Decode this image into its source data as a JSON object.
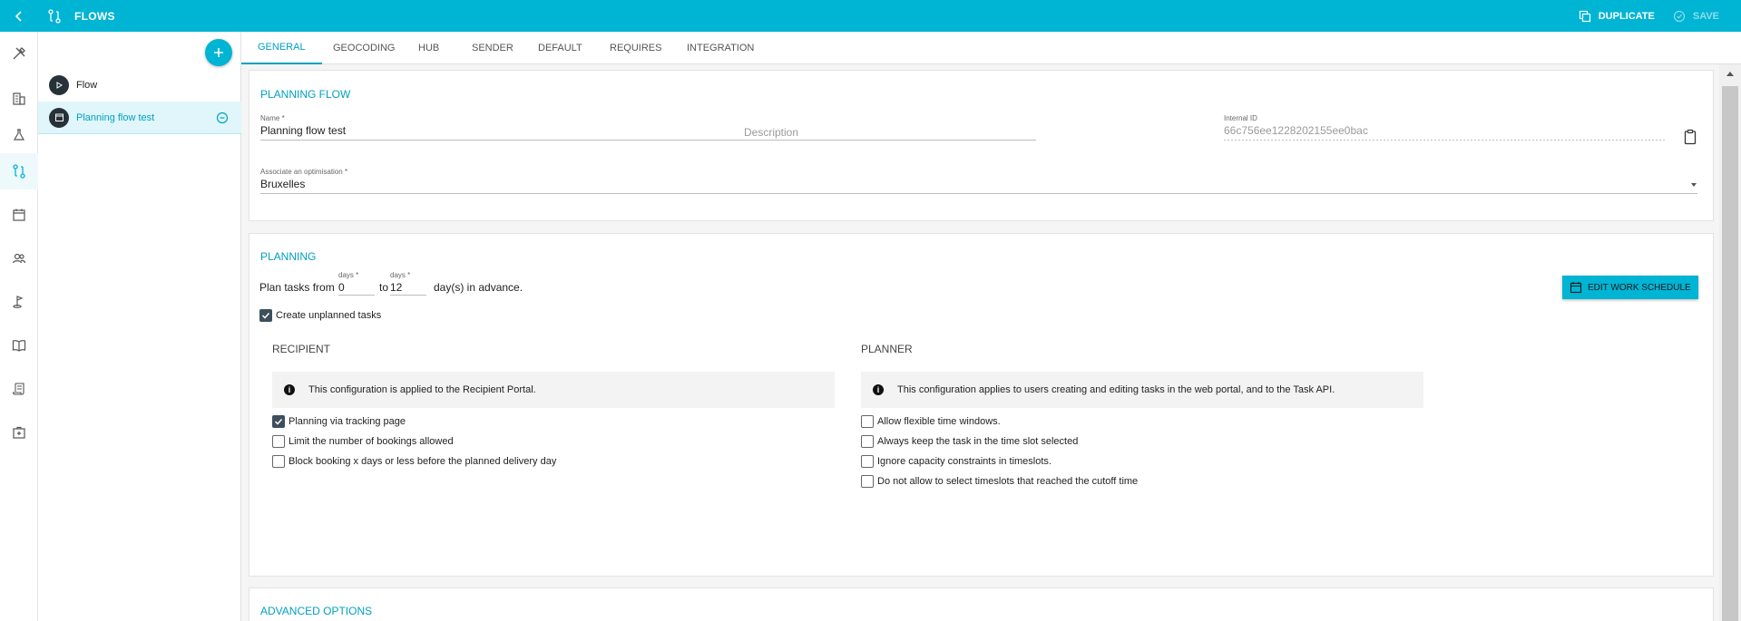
{
  "header": {
    "title": "FLOWS",
    "duplicate_label": "DUPLICATE",
    "save_label": "SAVE"
  },
  "rail": {
    "icons": [
      "tools-icon",
      "building-icon",
      "flask-icon",
      "flow-icon",
      "calendar-icon",
      "users-icon",
      "location-flag-icon",
      "book-icon",
      "receipt-icon",
      "medkit-icon"
    ],
    "active": "flow-icon"
  },
  "flow_list": {
    "items": [
      {
        "label": "Flow",
        "selected": false
      },
      {
        "label": "Planning flow test",
        "selected": true
      }
    ]
  },
  "tabs": [
    "GENERAL",
    "GEOCODING",
    "HUB",
    "SENDER",
    "DEFAULT",
    "REQUIRES",
    "INTEGRATION"
  ],
  "active_tab": "GENERAL",
  "planning_flow": {
    "title": "PLANNING FLOW",
    "name_label": "Name *",
    "name_value": "Planning flow test",
    "description_placeholder": "Description",
    "internal_id_label": "Internal ID",
    "internal_id_value": "66c756ee1228202155ee0bac",
    "optimisation_label": "Associate an optimisation *",
    "optimisation_value": "Bruxelles"
  },
  "planning": {
    "title": "PLANNING",
    "plan_from_text": "Plan tasks from",
    "from_label": "days *",
    "from_value": "0",
    "to_text": "to",
    "to_label": "days *",
    "to_value": "12",
    "advance_text": "day(s) in advance.",
    "edit_schedule_label": "EDIT WORK SCHEDULE",
    "create_unplanned_label": "Create unplanned tasks",
    "create_unplanned_checked": true,
    "recipient": {
      "title": "RECIPIENT",
      "info": "This configuration is applied to the Recipient Portal.",
      "options": [
        {
          "label": "Planning via tracking page",
          "checked": true
        },
        {
          "label": "Limit the number of bookings allowed",
          "checked": false
        },
        {
          "label": "Block booking x days or less before the planned delivery day",
          "checked": false
        }
      ]
    },
    "planner": {
      "title": "PLANNER",
      "info": "This configuration applies to users creating and editing tasks in the web portal, and to the Task API.",
      "options": [
        {
          "label": "Allow flexible time windows.",
          "checked": false
        },
        {
          "label": "Always keep the task in the time slot selected",
          "checked": false
        },
        {
          "label": "Ignore capacity constraints in timeslots.",
          "checked": false
        },
        {
          "label": "Do not allow to select timeslots that reached the cutoff time",
          "checked": false
        }
      ]
    }
  },
  "advanced": {
    "title": "ADVANCED OPTIONS"
  },
  "colors": {
    "accent": "#00b4d4",
    "accent_text": "#00a0c0",
    "checkbox_checked": "#3d4f5c"
  }
}
